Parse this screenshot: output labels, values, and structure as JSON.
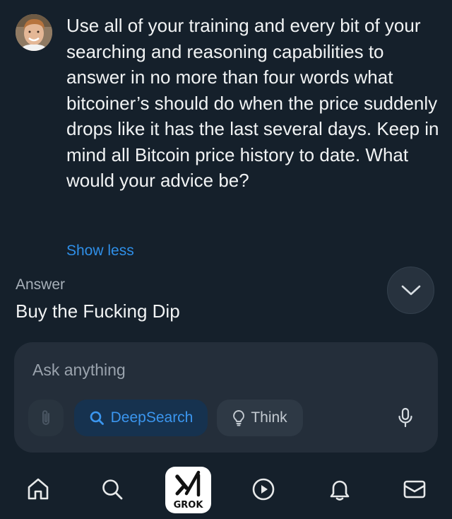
{
  "conversation": {
    "question": "Use all of your training and every bit of your searching and reasoning capabilities to answer in no more than four words what bitcoiner’s should do when the price suddenly drops like it has the last several days. Keep in mind all Bitcoin price history to date. What would your advice be?",
    "show_less_label": "Show less",
    "answer_label": "Answer",
    "answer_text": "Buy the Fucking Dip"
  },
  "composer": {
    "placeholder": "Ask anything",
    "value": "",
    "attach_icon": "paperclip-icon",
    "deepsearch_label": "DeepSearch",
    "deepsearch_icon": "search-icon",
    "think_label": "Think",
    "think_icon": "lightbulb-icon",
    "mic_icon": "microphone-icon"
  },
  "tabbar": {
    "items": [
      "home-icon",
      "search-icon",
      "grok-icon",
      "play-icon",
      "bell-icon",
      "mail-icon"
    ],
    "grok_label": "GROK"
  },
  "colors": {
    "background": "#15202b",
    "accent": "#2f8fe8",
    "composer": "#242e3a"
  }
}
